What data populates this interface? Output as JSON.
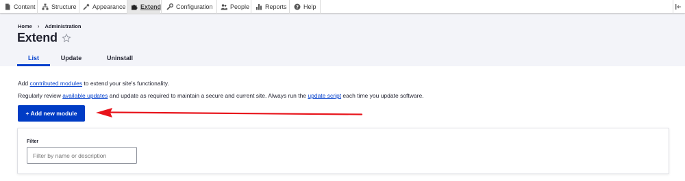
{
  "toolbar": {
    "items": [
      {
        "label": "Content",
        "icon": "content-icon"
      },
      {
        "label": "Structure",
        "icon": "structure-icon"
      },
      {
        "label": "Appearance",
        "icon": "appearance-icon"
      },
      {
        "label": "Extend",
        "icon": "extend-icon",
        "active": true
      },
      {
        "label": "Configuration",
        "icon": "configuration-icon"
      },
      {
        "label": "People",
        "icon": "people-icon"
      },
      {
        "label": "Reports",
        "icon": "reports-icon"
      },
      {
        "label": "Help",
        "icon": "help-icon"
      }
    ],
    "collapse_icon": "sidebar-collapse-icon"
  },
  "breadcrumb": {
    "home": "Home",
    "separator": "›",
    "administration": "Administration"
  },
  "page": {
    "title": "Extend",
    "favorite_icon": "star-outline-icon"
  },
  "tabs": [
    {
      "label": "List",
      "active": true
    },
    {
      "label": "Update",
      "active": false
    },
    {
      "label": "Uninstall",
      "active": false
    }
  ],
  "intro": {
    "line1_prefix": "Add ",
    "line1_link": "contributed modules",
    "line1_suffix": " to extend your site's functionality.",
    "line2_prefix": "Regularly review ",
    "line2_link1": "available updates",
    "line2_middle": " and update as required to maintain a secure and current site. Always run the ",
    "line2_link2": "update script",
    "line2_suffix": " each time you update software."
  },
  "actions": {
    "add_module_label": "+ Add new module"
  },
  "annotation": {
    "arrow_color": "#e8141b"
  },
  "filter": {
    "label": "Filter",
    "placeholder": "Filter by name or description"
  },
  "colors": {
    "accent": "#003ecc",
    "button": "#003cc5",
    "header_bg": "#f3f4f9"
  }
}
